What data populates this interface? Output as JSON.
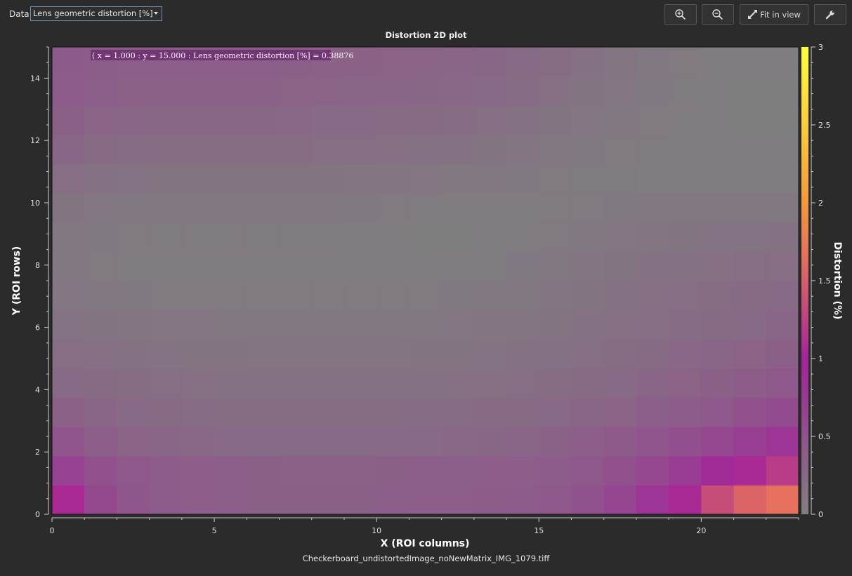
{
  "toolbar": {
    "data_label": "Data",
    "data_select_value": "Lens geometric distortion [%]",
    "zoom_in_icon": "zoom-in-icon",
    "zoom_out_icon": "zoom-out-icon",
    "fit_label": "Fit in view",
    "fit_icon": "expand-arrows-icon",
    "settings_icon": "wrench-icon"
  },
  "footer": {
    "filename": "Checkerboard_undistortedImage_noNewMatrix_IMG_1079.tiff"
  },
  "chart_data": {
    "type": "heatmap",
    "title": "Distortion 2D plot",
    "xlabel": "X (ROI columns)",
    "ylabel": "Y (ROI rows)",
    "colorbar_label": "Distortion (%)",
    "xlim": [
      0,
      23
    ],
    "ylim": [
      0,
      15
    ],
    "x_ticks": [
      0,
      5,
      10,
      15,
      20
    ],
    "y_ticks": [
      0,
      2,
      4,
      6,
      8,
      10,
      12,
      14
    ],
    "colorbar_range": [
      0,
      3
    ],
    "colorbar_ticks": [
      {
        "value": 0,
        "label": "0"
      },
      {
        "value": 0.5,
        "label": "0.5"
      },
      {
        "value": 1,
        "label": "1"
      },
      {
        "value": 1.5,
        "label": "1.5"
      },
      {
        "value": 2,
        "label": "2"
      },
      {
        "value": 2.5,
        "label": "2.5"
      },
      {
        "value": 3,
        "label": "3"
      }
    ],
    "colormap": [
      "#7f7f7f",
      "#a3239b",
      "#e4705d",
      "#f49a3c",
      "#ffff3a"
    ],
    "grid": false,
    "tooltip": "( x = 1.000 : y = 15.000 : Lens geometric distortion [%] = 0.38876",
    "values": [
      [
        1.05,
        0.58,
        0.44,
        0.38,
        0.35,
        0.34,
        0.33,
        0.33,
        0.33,
        0.33,
        0.34,
        0.35,
        0.36,
        0.37,
        0.38,
        0.42,
        0.48,
        0.62,
        0.8,
        1.05,
        1.35,
        1.55,
        1.65
      ],
      [
        0.66,
        0.5,
        0.42,
        0.38,
        0.35,
        0.34,
        0.33,
        0.32,
        0.32,
        0.32,
        0.33,
        0.34,
        0.34,
        0.35,
        0.36,
        0.38,
        0.42,
        0.5,
        0.6,
        0.72,
        0.9,
        1.05,
        1.2
      ],
      [
        0.45,
        0.36,
        0.3,
        0.27,
        0.25,
        0.24,
        0.23,
        0.23,
        0.23,
        0.23,
        0.24,
        0.24,
        0.25,
        0.26,
        0.28,
        0.31,
        0.35,
        0.4,
        0.45,
        0.52,
        0.6,
        0.7,
        0.8
      ],
      [
        0.32,
        0.27,
        0.24,
        0.22,
        0.2,
        0.19,
        0.19,
        0.19,
        0.19,
        0.19,
        0.19,
        0.2,
        0.2,
        0.21,
        0.22,
        0.24,
        0.27,
        0.3,
        0.34,
        0.38,
        0.42,
        0.5,
        0.56
      ],
      [
        0.24,
        0.21,
        0.19,
        0.17,
        0.16,
        0.15,
        0.15,
        0.15,
        0.15,
        0.15,
        0.15,
        0.15,
        0.16,
        0.16,
        0.17,
        0.19,
        0.21,
        0.24,
        0.27,
        0.3,
        0.33,
        0.37,
        0.42
      ],
      [
        0.18,
        0.16,
        0.14,
        0.13,
        0.12,
        0.12,
        0.11,
        0.11,
        0.11,
        0.11,
        0.11,
        0.12,
        0.12,
        0.13,
        0.14,
        0.15,
        0.17,
        0.19,
        0.22,
        0.25,
        0.27,
        0.3,
        0.33
      ],
      [
        0.13,
        0.12,
        0.1,
        0.09,
        0.09,
        0.08,
        0.08,
        0.08,
        0.08,
        0.08,
        0.08,
        0.08,
        0.09,
        0.1,
        0.11,
        0.12,
        0.14,
        0.16,
        0.18,
        0.2,
        0.22,
        0.24,
        0.27
      ],
      [
        0.09,
        0.08,
        0.06,
        0.05,
        0.05,
        0.05,
        0.05,
        0.05,
        0.05,
        0.05,
        0.05,
        0.05,
        0.06,
        0.07,
        0.08,
        0.1,
        0.12,
        0.14,
        0.16,
        0.18,
        0.19,
        0.21,
        0.23
      ],
      [
        0.07,
        0.05,
        0.04,
        0.03,
        0.03,
        0.03,
        0.03,
        0.03,
        0.03,
        0.02,
        0.02,
        0.02,
        0.03,
        0.04,
        0.06,
        0.08,
        0.1,
        0.12,
        0.14,
        0.15,
        0.16,
        0.17,
        0.18
      ],
      [
        0.08,
        0.06,
        0.05,
        0.04,
        0.04,
        0.04,
        0.04,
        0.04,
        0.04,
        0.03,
        0.02,
        0.01,
        0.01,
        0.02,
        0.03,
        0.05,
        0.07,
        0.09,
        0.11,
        0.12,
        0.13,
        0.13,
        0.14
      ],
      [
        0.12,
        0.09,
        0.08,
        0.07,
        0.07,
        0.07,
        0.07,
        0.07,
        0.07,
        0.06,
        0.05,
        0.04,
        0.03,
        0.03,
        0.03,
        0.04,
        0.05,
        0.06,
        0.07,
        0.07,
        0.07,
        0.07,
        0.07
      ],
      [
        0.18,
        0.15,
        0.13,
        0.12,
        0.12,
        0.12,
        0.12,
        0.12,
        0.12,
        0.11,
        0.1,
        0.09,
        0.08,
        0.07,
        0.06,
        0.05,
        0.04,
        0.04,
        0.03,
        0.03,
        0.03,
        0.03,
        0.03
      ],
      [
        0.26,
        0.22,
        0.2,
        0.19,
        0.19,
        0.19,
        0.19,
        0.19,
        0.18,
        0.17,
        0.16,
        0.15,
        0.14,
        0.12,
        0.1,
        0.08,
        0.06,
        0.05,
        0.04,
        0.03,
        0.02,
        0.02,
        0.02
      ],
      [
        0.33,
        0.29,
        0.27,
        0.26,
        0.26,
        0.26,
        0.26,
        0.25,
        0.24,
        0.23,
        0.22,
        0.21,
        0.2,
        0.18,
        0.15,
        0.12,
        0.09,
        0.07,
        0.05,
        0.03,
        0.02,
        0.01,
        0.01
      ],
      [
        0.38,
        0.34,
        0.32,
        0.32,
        0.32,
        0.32,
        0.31,
        0.3,
        0.29,
        0.28,
        0.27,
        0.26,
        0.25,
        0.23,
        0.2,
        0.16,
        0.12,
        0.09,
        0.06,
        0.04,
        0.02,
        0.01,
        0.01
      ],
      [
        0.39,
        0.37,
        0.35,
        0.35,
        0.35,
        0.35,
        0.34,
        0.33,
        0.32,
        0.31,
        0.3,
        0.29,
        0.28,
        0.26,
        0.23,
        0.19,
        0.15,
        0.11,
        0.08,
        0.05,
        0.03,
        0.02,
        0.02
      ]
    ]
  }
}
